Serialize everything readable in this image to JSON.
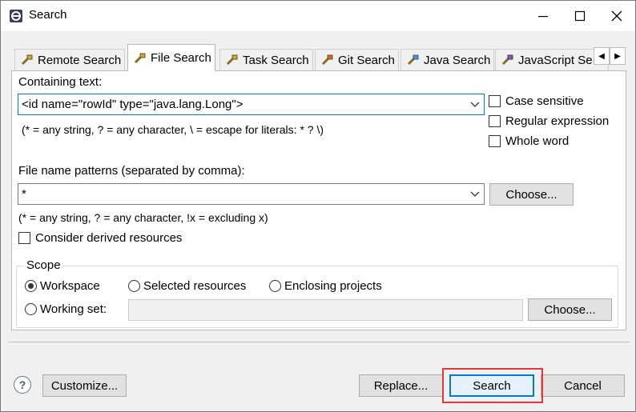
{
  "window": {
    "title": "Search"
  },
  "tabs": [
    {
      "label": "Remote Search",
      "icon": "remote-search-icon"
    },
    {
      "label": "File Search",
      "icon": "file-search-icon",
      "active": true
    },
    {
      "label": "Task Search",
      "icon": "task-search-icon"
    },
    {
      "label": "Git Search",
      "icon": "git-search-icon"
    },
    {
      "label": "Java Search",
      "icon": "java-search-icon"
    },
    {
      "label": "JavaScript Se",
      "icon": "javascript-search-icon"
    }
  ],
  "containing": {
    "label": "Containing text:",
    "value": "<id name=\"rowId\" type=\"java.lang.Long\">",
    "hint": "(* = any string, ? = any character, \\ = escape for literals: * ? \\)",
    "case_sensitive": "Case sensitive",
    "regex": "Regular expression",
    "whole_word": "Whole word"
  },
  "patterns": {
    "label": "File name patterns (separated by comma):",
    "value": "*",
    "hint": "(* = any string, ? = any character, !x = excluding x)",
    "choose": "Choose...",
    "derived": "Consider derived resources"
  },
  "scope": {
    "title": "Scope",
    "workspace": "Workspace",
    "selected": "Selected resources",
    "enclosing": "Enclosing projects",
    "working_set": "Working set:",
    "choose": "Choose...",
    "selected_option": "Workspace"
  },
  "footer": {
    "customize": "Customize...",
    "replace": "Replace...",
    "search": "Search",
    "cancel": "Cancel"
  },
  "colors": {
    "accent": "#0078d7",
    "highlight": "#e53935"
  }
}
